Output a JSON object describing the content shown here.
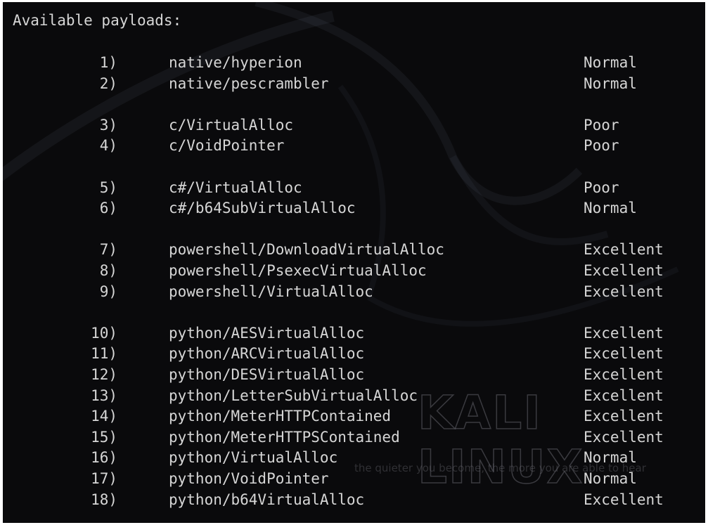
{
  "header": "Available payloads:",
  "watermark": {
    "logo_text": "KALI LINUX",
    "tagline": "the quieter you become, the more you are able to hear"
  },
  "payloads": [
    {
      "num": "1)",
      "name": "native/hyperion",
      "rating": "Normal"
    },
    {
      "num": "2)",
      "name": "native/pescrambler",
      "rating": "Normal"
    },
    {
      "num": "3)",
      "name": "c/VirtualAlloc",
      "rating": "Poor"
    },
    {
      "num": "4)",
      "name": "c/VoidPointer",
      "rating": "Poor"
    },
    {
      "num": "5)",
      "name": "c#/VirtualAlloc",
      "rating": "Poor"
    },
    {
      "num": "6)",
      "name": "c#/b64SubVirtualAlloc",
      "rating": "Normal"
    },
    {
      "num": "7)",
      "name": "powershell/DownloadVirtualAlloc",
      "rating": "Excellent"
    },
    {
      "num": "8)",
      "name": "powershell/PsexecVirtualAlloc",
      "rating": "Excellent"
    },
    {
      "num": "9)",
      "name": "powershell/VirtualAlloc",
      "rating": "Excellent"
    },
    {
      "num": "10)",
      "name": "python/AESVirtualAlloc",
      "rating": "Excellent"
    },
    {
      "num": "11)",
      "name": "python/ARCVirtualAlloc",
      "rating": "Excellent"
    },
    {
      "num": "12)",
      "name": "python/DESVirtualAlloc",
      "rating": "Excellent"
    },
    {
      "num": "13)",
      "name": "python/LetterSubVirtualAlloc",
      "rating": "Excellent"
    },
    {
      "num": "14)",
      "name": "python/MeterHTTPContained",
      "rating": "Excellent"
    },
    {
      "num": "15)",
      "name": "python/MeterHTTPSContained",
      "rating": "Excellent"
    },
    {
      "num": "16)",
      "name": "python/VirtualAlloc",
      "rating": "Normal"
    },
    {
      "num": "17)",
      "name": "python/VoidPointer",
      "rating": "Normal"
    },
    {
      "num": "18)",
      "name": "python/b64VirtualAlloc",
      "rating": "Excellent"
    }
  ]
}
